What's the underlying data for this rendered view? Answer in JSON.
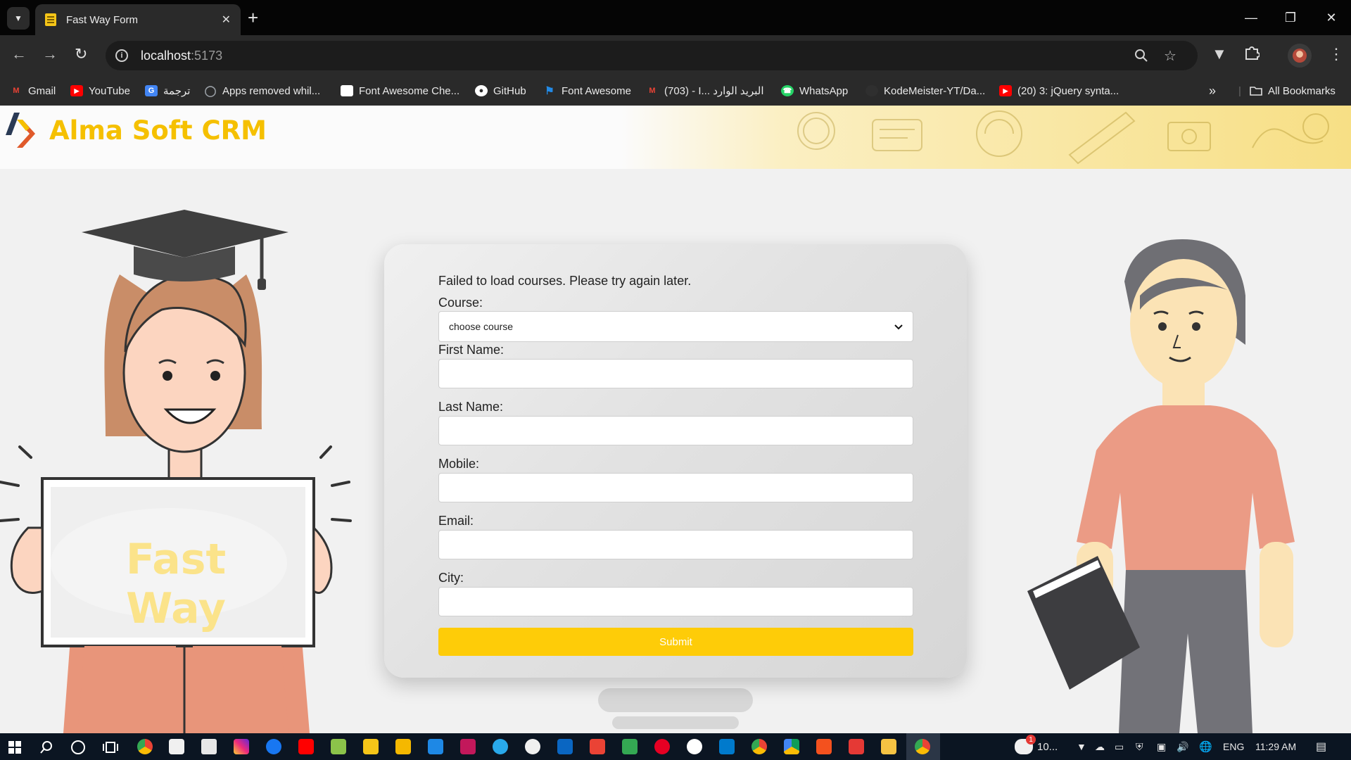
{
  "browser": {
    "tab_title": "Fast Way Form",
    "url_host": "localhost",
    "url_port": ":5173",
    "bookmarks": [
      {
        "label": "Gmail",
        "icon": "gmail-icon",
        "color": "#ea4335"
      },
      {
        "label": "YouTube",
        "icon": "youtube-icon",
        "color": "#ff0000"
      },
      {
        "label": "ترجمة",
        "icon": "translate-icon",
        "color": "#4285f4"
      },
      {
        "label": "Apps removed whil...",
        "icon": "globe-icon",
        "color": "#9aa0a6"
      },
      {
        "label": "Font Awesome Che...",
        "icon": "page-icon",
        "color": "#ffffff"
      },
      {
        "label": "GitHub",
        "icon": "github-icon",
        "color": "#ffffff"
      },
      {
        "label": "Font Awesome",
        "icon": "flag-icon",
        "color": "#228ae6"
      },
      {
        "label": "(703) - I... البريد الوارد",
        "icon": "gmail-icon",
        "color": "#ea4335"
      },
      {
        "label": "WhatsApp",
        "icon": "whatsapp-icon",
        "color": "#25d366"
      },
      {
        "label": "KodeMeister-YT/Da...",
        "icon": "github-icon",
        "color": "#2a2a2a"
      },
      {
        "label": "(20) 3: jQuery synta...",
        "icon": "youtube-icon",
        "color": "#ff0000"
      }
    ],
    "all_bookmarks": "All Bookmarks"
  },
  "header": {
    "brand": "Alma Soft CRM"
  },
  "illustration": {
    "sign_text": "Fast Way"
  },
  "form": {
    "error_message": "Failed to load courses. Please try again later.",
    "course_label": "Course:",
    "course_selected": "choose course",
    "first_name_label": "First Name:",
    "last_name_label": "Last Name:",
    "mobile_label": "Mobile:",
    "email_label": "Email:",
    "city_label": "City:",
    "submit_label": "Submit",
    "accent_color": "#fecc08"
  },
  "taskbar": {
    "weather": "10...",
    "language": "ENG",
    "time": "11:29 AM",
    "notification_count": "1"
  }
}
